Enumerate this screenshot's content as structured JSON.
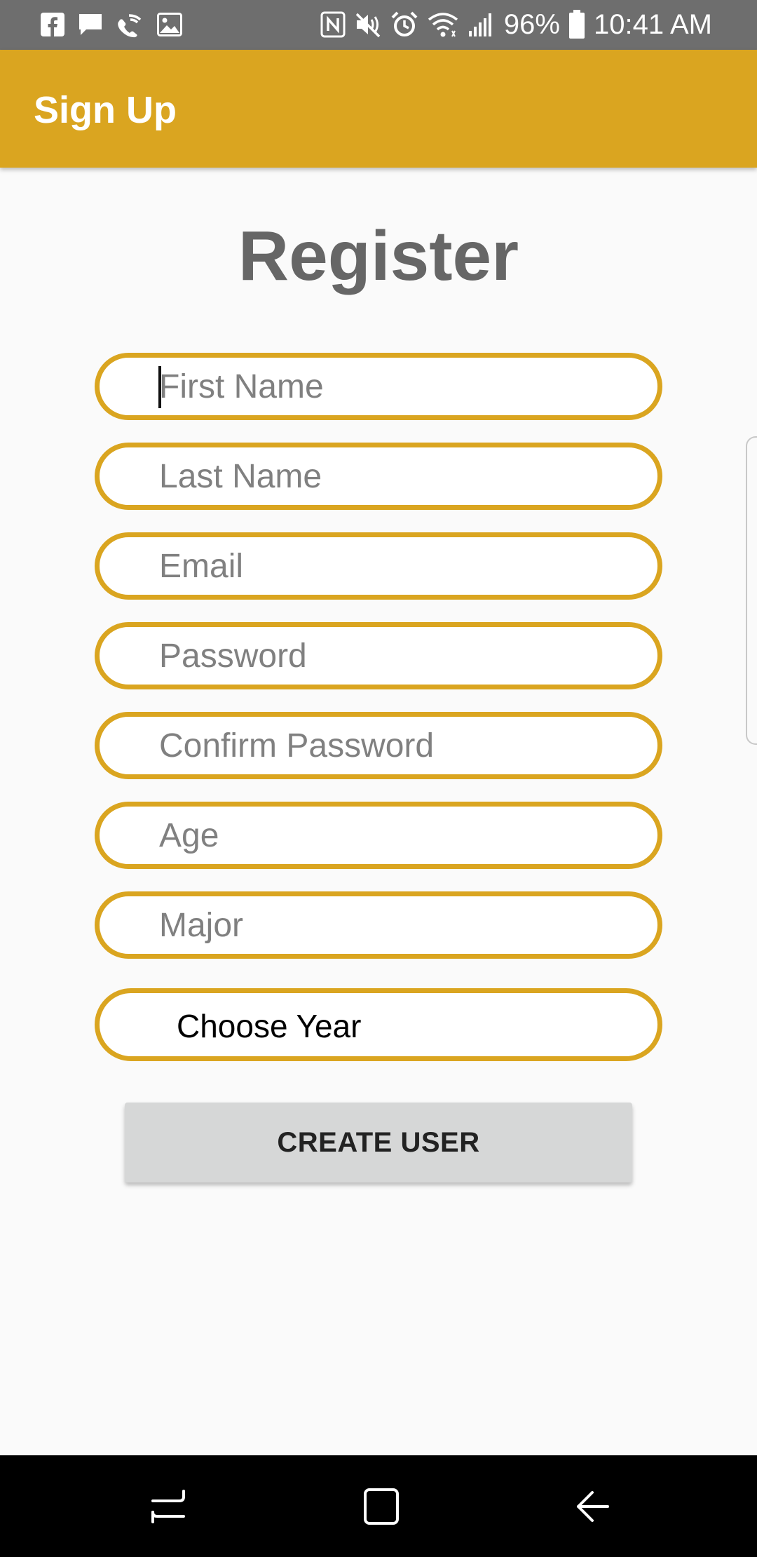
{
  "status_bar": {
    "battery_percent": "96%",
    "time": "10:41 AM",
    "left_icons": [
      "facebook-icon",
      "message-icon",
      "wifi-call-icon",
      "gallery-icon"
    ],
    "right_icons": [
      "nfc-icon",
      "mute-icon",
      "alarm-icon",
      "wifi-icon",
      "signal-icon",
      "battery-icon"
    ]
  },
  "app_bar": {
    "title": "Sign Up",
    "color": "#daa520"
  },
  "main": {
    "heading": "Register",
    "fields": [
      {
        "name": "first-name",
        "placeholder": "First Name",
        "value": "",
        "focused": true
      },
      {
        "name": "last-name",
        "placeholder": "Last Name",
        "value": ""
      },
      {
        "name": "email",
        "placeholder": "Email",
        "value": ""
      },
      {
        "name": "password",
        "placeholder": "Password",
        "value": ""
      },
      {
        "name": "confirm-password",
        "placeholder": "Confirm Password",
        "value": ""
      },
      {
        "name": "age",
        "placeholder": "Age",
        "value": ""
      },
      {
        "name": "major",
        "placeholder": "Major",
        "value": ""
      }
    ],
    "year_select": {
      "value": "Choose Year"
    },
    "create_button": {
      "label": "CREATE USER"
    }
  },
  "nav_bar": {
    "buttons": [
      "recent-apps-icon",
      "home-icon",
      "back-icon"
    ]
  }
}
